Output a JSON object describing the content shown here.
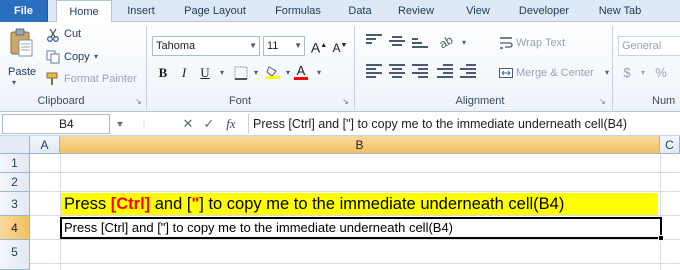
{
  "tabs": [
    {
      "label": "File"
    },
    {
      "label": "Home"
    },
    {
      "label": "Insert"
    },
    {
      "label": "Page Layout"
    },
    {
      "label": "Formulas"
    },
    {
      "label": "Data"
    },
    {
      "label": "Review"
    },
    {
      "label": "View"
    },
    {
      "label": "Developer"
    },
    {
      "label": "New Tab"
    }
  ],
  "ribbon": {
    "clipboard": {
      "label": "Clipboard",
      "paste": "Paste",
      "cut": "Cut",
      "copy": "Copy",
      "format_painter": "Format Painter"
    },
    "font": {
      "label": "Font",
      "font_name": "Tahoma",
      "font_size": "11"
    },
    "alignment": {
      "label": "Alignment",
      "wrap_text": "Wrap Text",
      "merge_center": "Merge & Center"
    },
    "number": {
      "label": "Num",
      "format": "General"
    }
  },
  "formula_bar": {
    "name_box": "B4",
    "fx": "fx",
    "content": "Press [Ctrl] and [\"] to copy me to the immediate underneath cell(B4)"
  },
  "grid": {
    "columns": [
      "A",
      "B",
      "C"
    ],
    "rows": [
      "1",
      "2",
      "3",
      "4",
      "5"
    ],
    "selected_cell": "B4",
    "b3": {
      "part1": "Press ",
      "part2": "[Ctrl]",
      "part3": " and [",
      "part4": "\"",
      "part5": "] to copy me to the immediate underneath cell(B4)"
    },
    "b4": "Press [Ctrl] and [\"] to copy me to the immediate underneath cell(B4)"
  },
  "colors": {
    "file_tab": "#2a6fbe",
    "highlight": "#ffff00",
    "accent_text": "#ff0000",
    "selected_header": "#f1c15f"
  }
}
